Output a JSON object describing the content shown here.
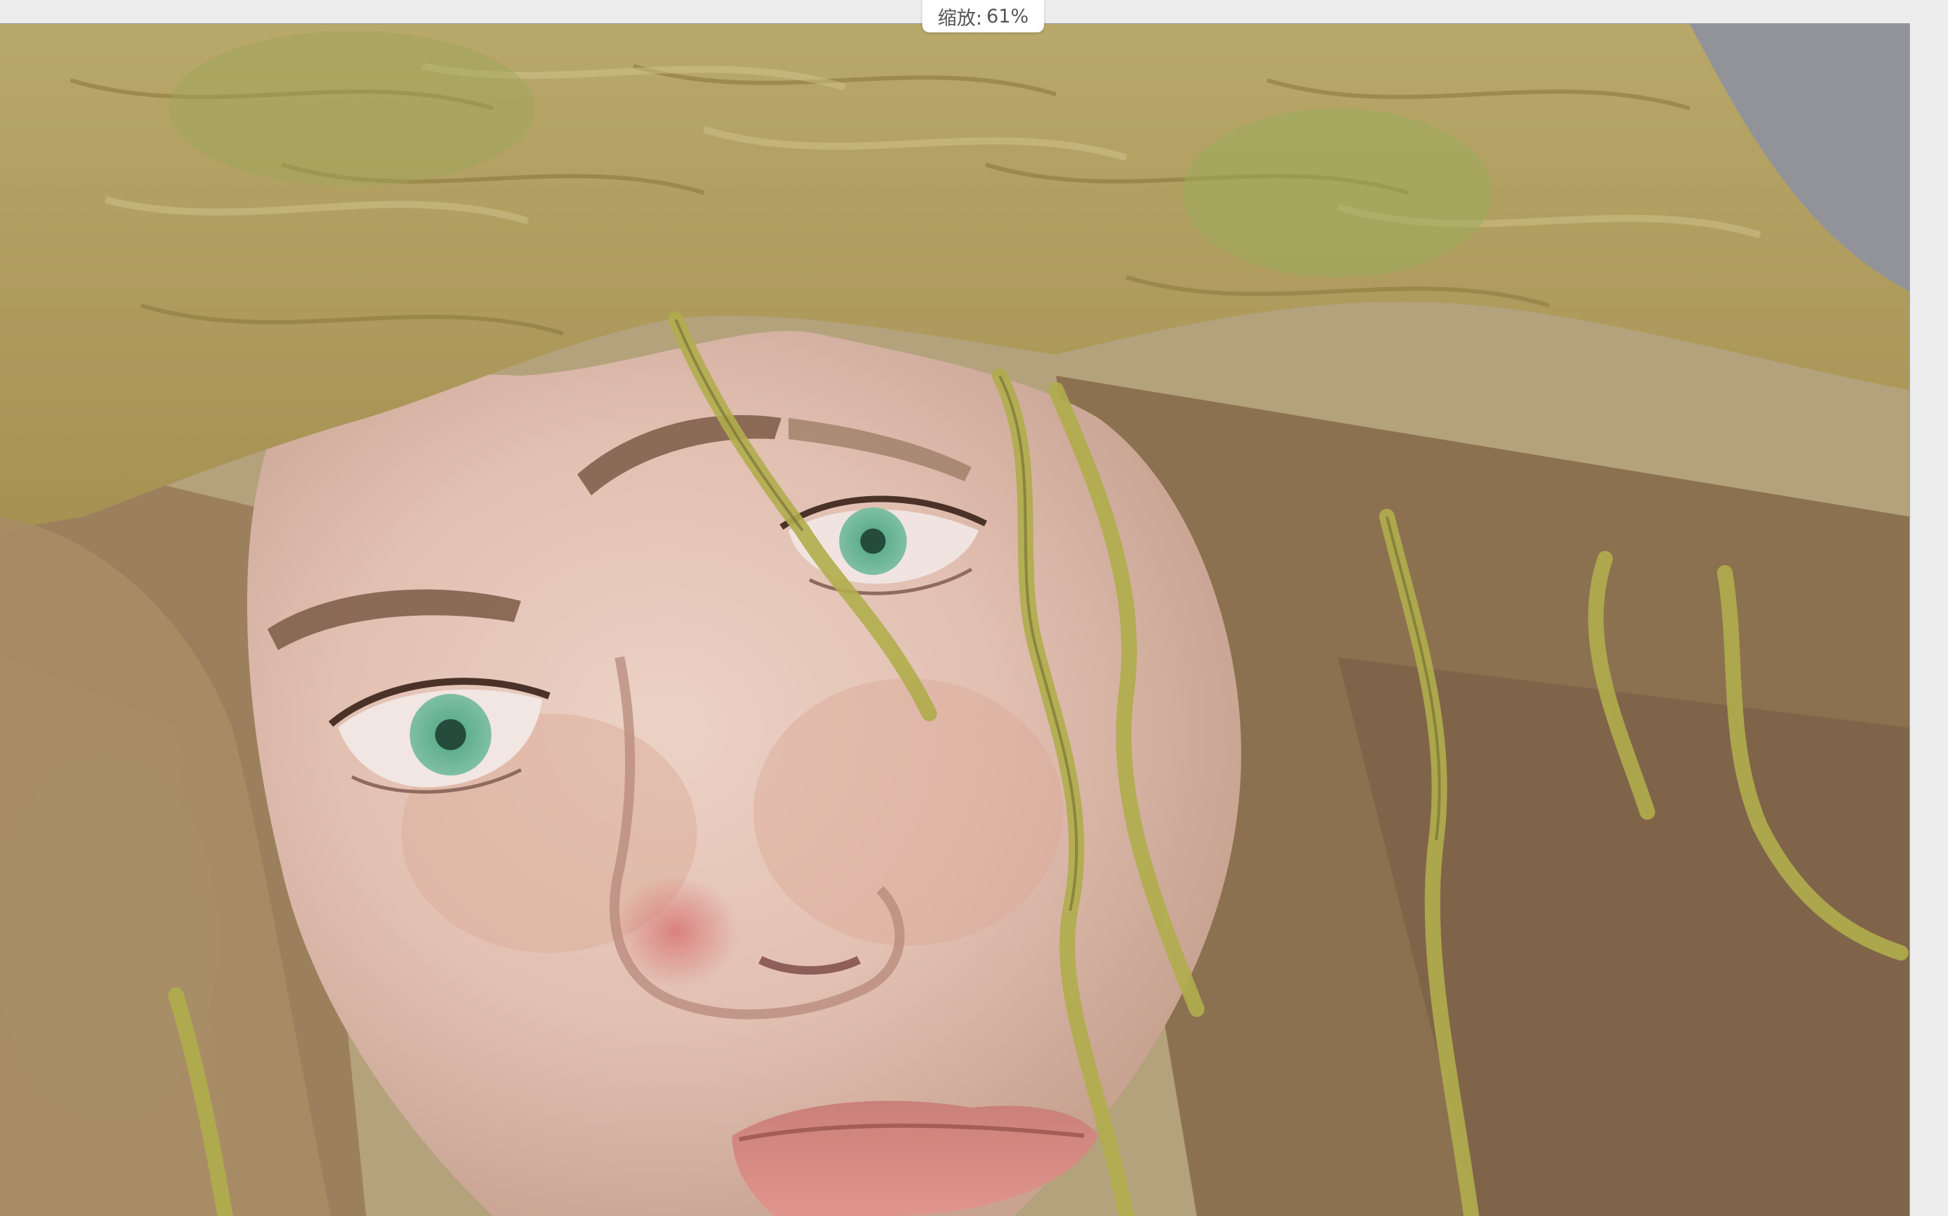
{
  "zoom": {
    "label": "缩放:",
    "value": "61%"
  },
  "canvas": {
    "content": "painting-portrait",
    "colors": {
      "hair_gold": "#b6a45e",
      "hair_brown": "#8a6e4c",
      "skin": "#e3c3b7",
      "skin_shadow": "#c9a091",
      "eye_green": "#5fae8c",
      "lips": "#d98a82",
      "vines": "#a9a84a",
      "background_grey": "#8d8f9a"
    }
  }
}
